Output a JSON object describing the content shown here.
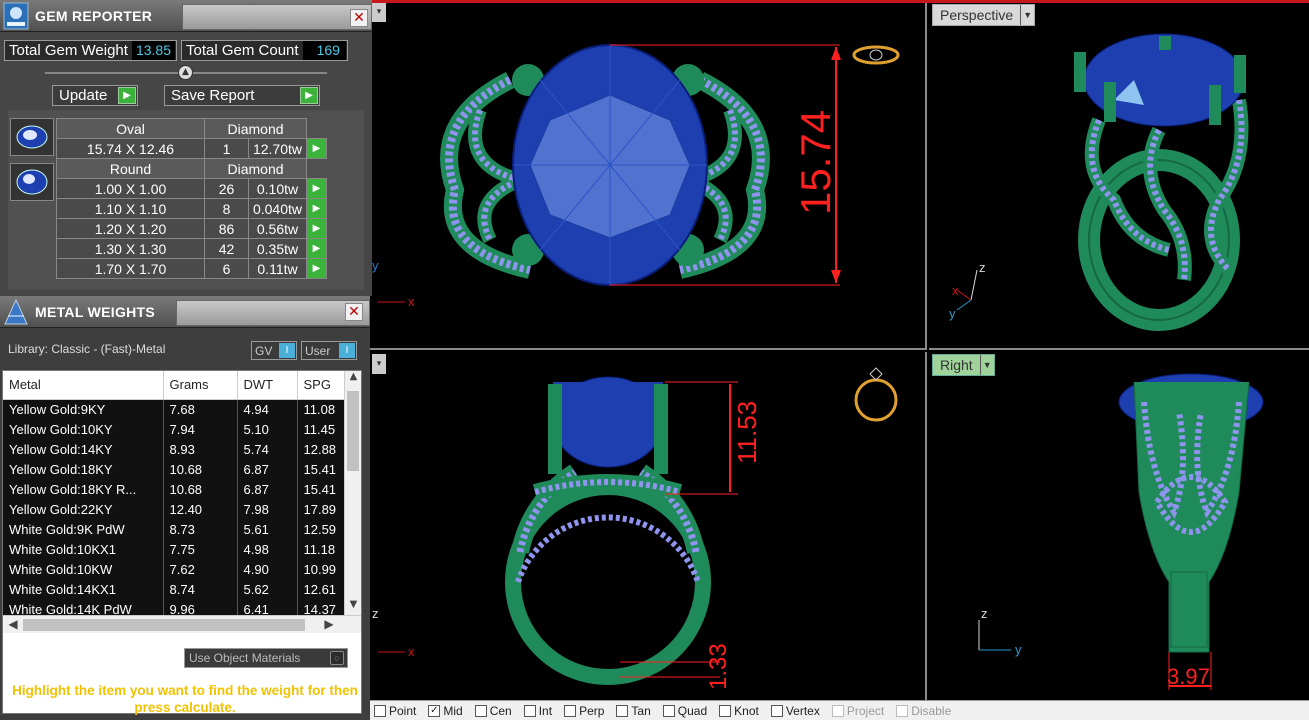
{
  "gem_reporter": {
    "title": "GEM REPORTER",
    "total_weight_label": "Total Gem Weight",
    "total_weight_value": "13.85",
    "total_count_label": "Total Gem Count",
    "total_count_value": "169",
    "update_label": "Update",
    "save_report_label": "Save Report",
    "oval": {
      "shape": "Oval",
      "material": "Diamond",
      "rows": [
        {
          "size": "15.74 X 12.46",
          "count": "1",
          "weight": "12.70tw"
        }
      ]
    },
    "round": {
      "shape": "Round",
      "material": "Diamond",
      "rows": [
        {
          "size": "1.00 X 1.00",
          "count": "26",
          "weight": "0.10tw"
        },
        {
          "size": "1.10 X 1.10",
          "count": "8",
          "weight": "0.040tw"
        },
        {
          "size": "1.20 X 1.20",
          "count": "86",
          "weight": "0.56tw"
        },
        {
          "size": "1.30 X 1.30",
          "count": "42",
          "weight": "0.35tw"
        },
        {
          "size": "1.70 X 1.70",
          "count": "6",
          "weight": "0.11tw"
        }
      ]
    }
  },
  "metal_weights": {
    "title": "METAL WEIGHTS",
    "library": "Library: Classic - (Fast)-Metal",
    "gv_label": "GV",
    "user_label": "User",
    "columns": [
      "Metal",
      "Grams",
      "DWT",
      "SPG"
    ],
    "rows": [
      [
        "Yellow Gold:9KY",
        "7.68",
        "4.94",
        "11.08"
      ],
      [
        "Yellow Gold:10KY",
        "7.94",
        "5.10",
        "11.45"
      ],
      [
        "Yellow Gold:14KY",
        "8.93",
        "5.74",
        "12.88"
      ],
      [
        "Yellow Gold:18KY",
        "10.68",
        "6.87",
        "15.41"
      ],
      [
        "Yellow Gold:18KY R...",
        "10.68",
        "6.87",
        "15.41"
      ],
      [
        "Yellow Gold:22KY",
        "12.40",
        "7.98",
        "17.89"
      ],
      [
        "White Gold:9K PdW",
        "8.73",
        "5.61",
        "12.59"
      ],
      [
        "White Gold:10KX1",
        "7.75",
        "4.98",
        "11.18"
      ],
      [
        "White Gold:10KW",
        "7.62",
        "4.90",
        "10.99"
      ],
      [
        "White Gold:14KX1",
        "8.74",
        "5.62",
        "12.61"
      ],
      [
        "White Gold:14K PdW",
        "9.96",
        "6.41",
        "14.37"
      ]
    ],
    "use_object_materials": "Use Object Materials",
    "hint": "Highlight the item you want to find the weight for then press calculate."
  },
  "viewports": {
    "perspective_label": "Perspective",
    "right_label": "Right",
    "top_dimension": "15.74",
    "front_dimension_height": "11.53",
    "front_dimension_band": "1.33",
    "right_dimension": "3.97",
    "axis_x": "x",
    "axis_y": "y",
    "axis_z": "z"
  },
  "snaps": [
    {
      "label": "Point",
      "checked": false
    },
    {
      "label": "Mid",
      "checked": true
    },
    {
      "label": "Cen",
      "checked": false
    },
    {
      "label": "Int",
      "checked": false
    },
    {
      "label": "Perp",
      "checked": false
    },
    {
      "label": "Tan",
      "checked": false
    },
    {
      "label": "Quad",
      "checked": false
    },
    {
      "label": "Knot",
      "checked": false
    },
    {
      "label": "Vertex",
      "checked": false
    },
    {
      "label": "Project",
      "checked": false,
      "disabled": true
    },
    {
      "label": "Disable",
      "checked": false,
      "disabled": true
    }
  ],
  "colors": {
    "metal_green": "#1f8a5a",
    "gem_blue": "#1d3fb0",
    "pave_lavender": "#9fa4f0",
    "dimension_red": "#ff2020",
    "hint_yellow": "#f2c200",
    "value_cyan": "#4fc8e8"
  }
}
